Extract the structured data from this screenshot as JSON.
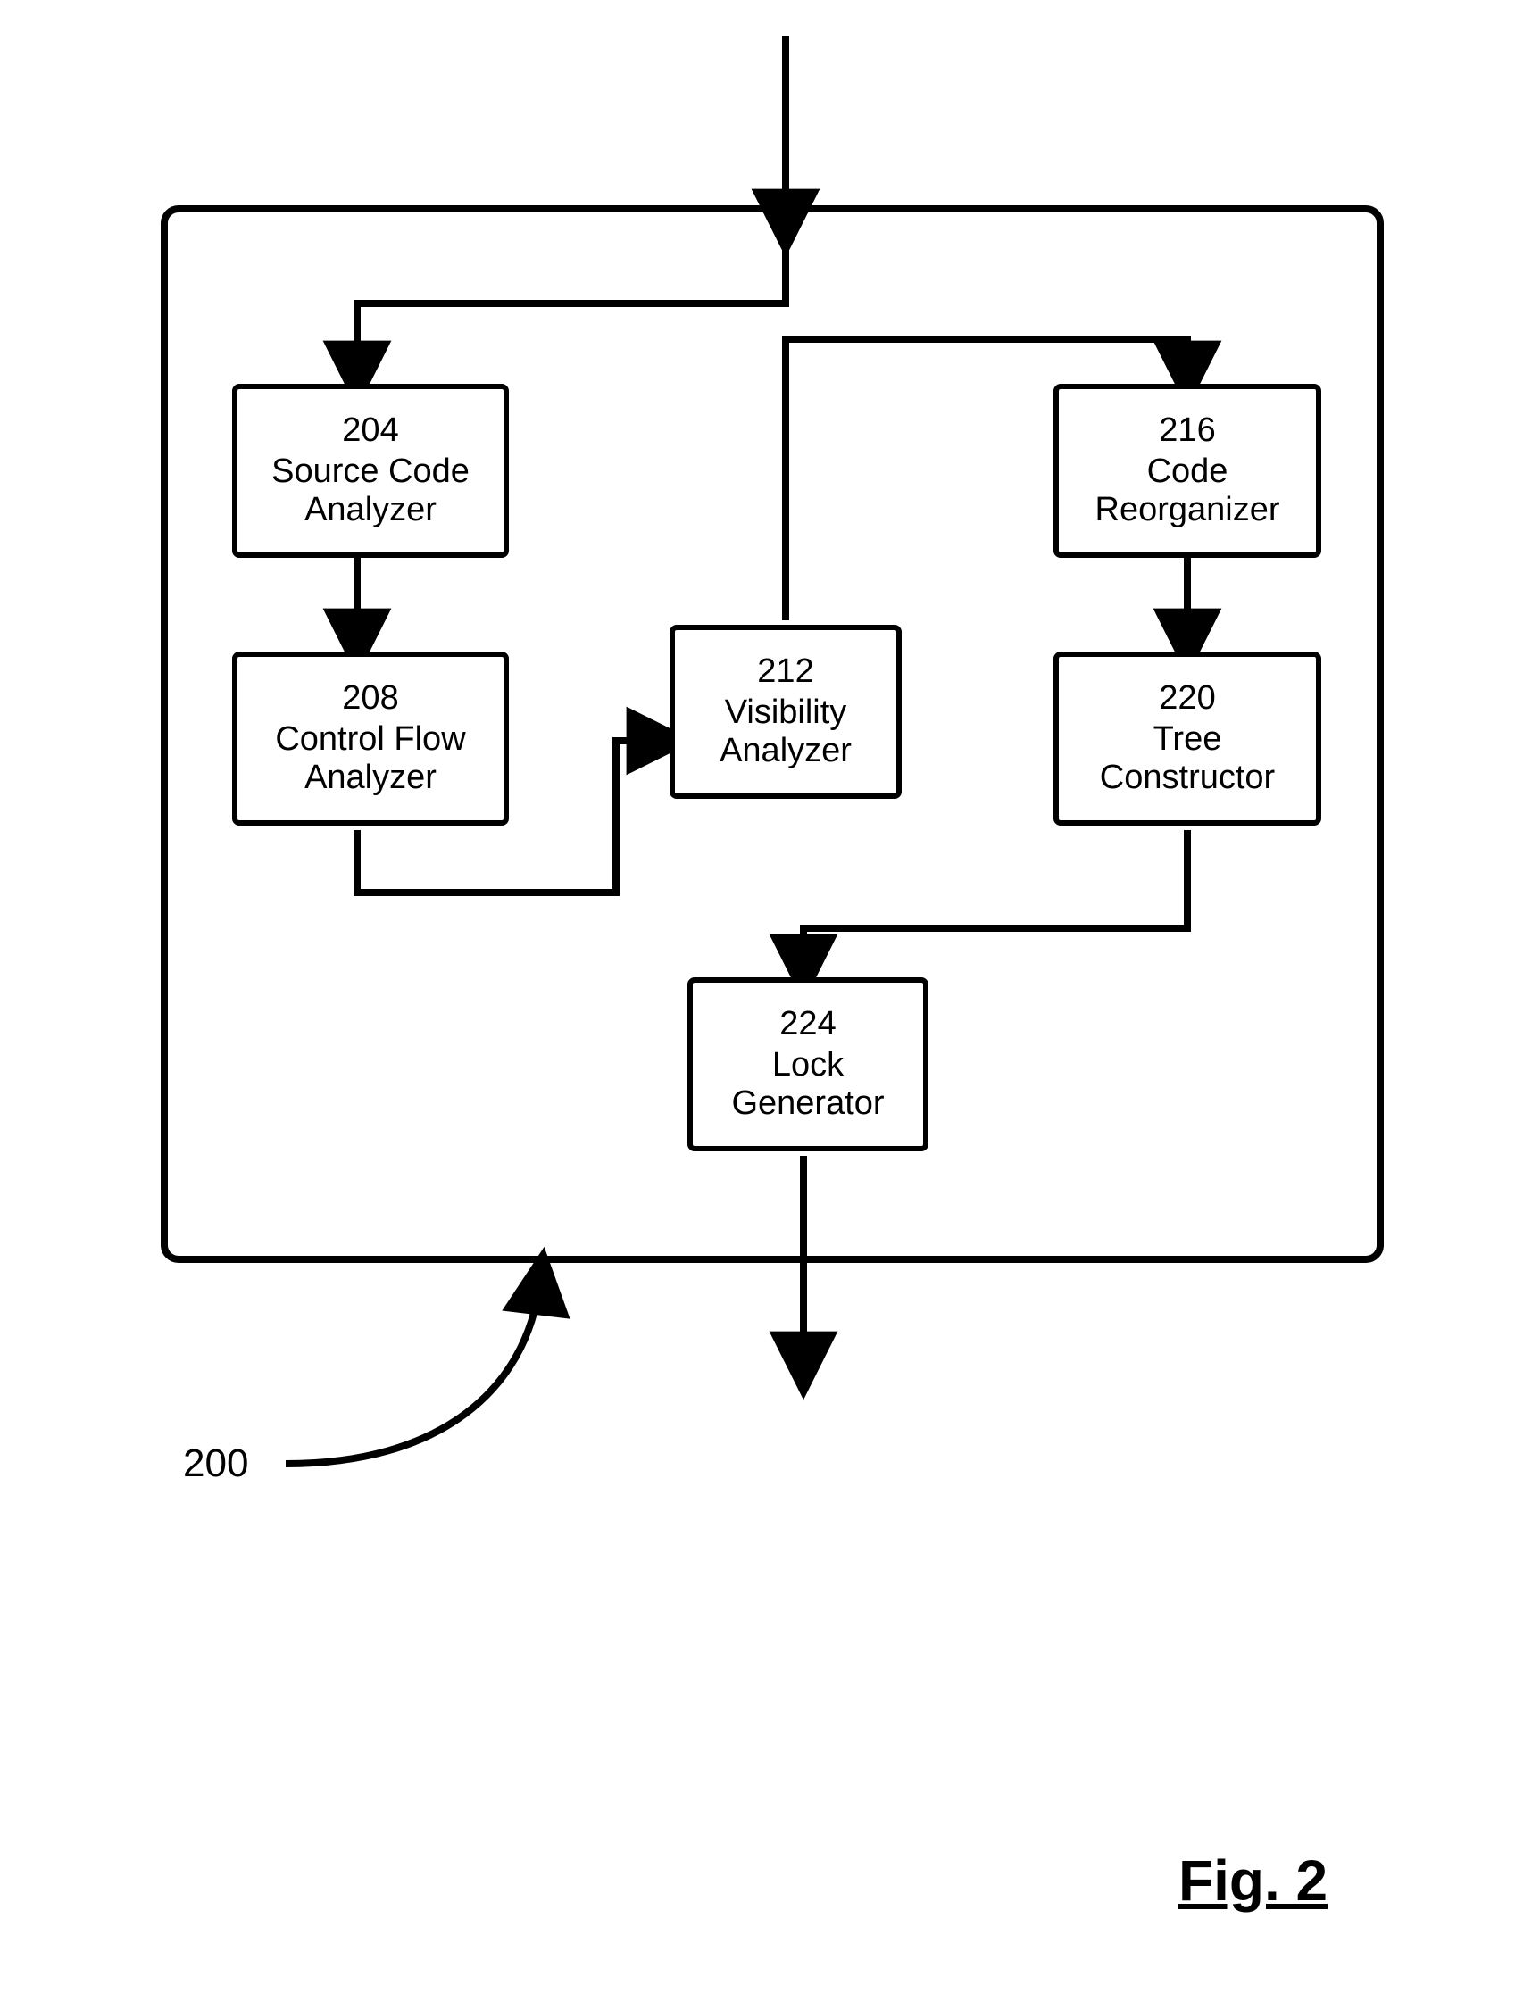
{
  "figure_label": "Fig. 2",
  "container_ref": "200",
  "blocks": {
    "b204": {
      "num": "204",
      "label": "Source Code\nAnalyzer"
    },
    "b208": {
      "num": "208",
      "label": "Control Flow\nAnalyzer"
    },
    "b212": {
      "num": "212",
      "label": "Visibility\nAnalyzer"
    },
    "b216": {
      "num": "216",
      "label": "Code\nReorganizer"
    },
    "b220": {
      "num": "220",
      "label": "Tree\nConstructor"
    },
    "b224": {
      "num": "224",
      "label": "Lock\nGenerator"
    }
  }
}
